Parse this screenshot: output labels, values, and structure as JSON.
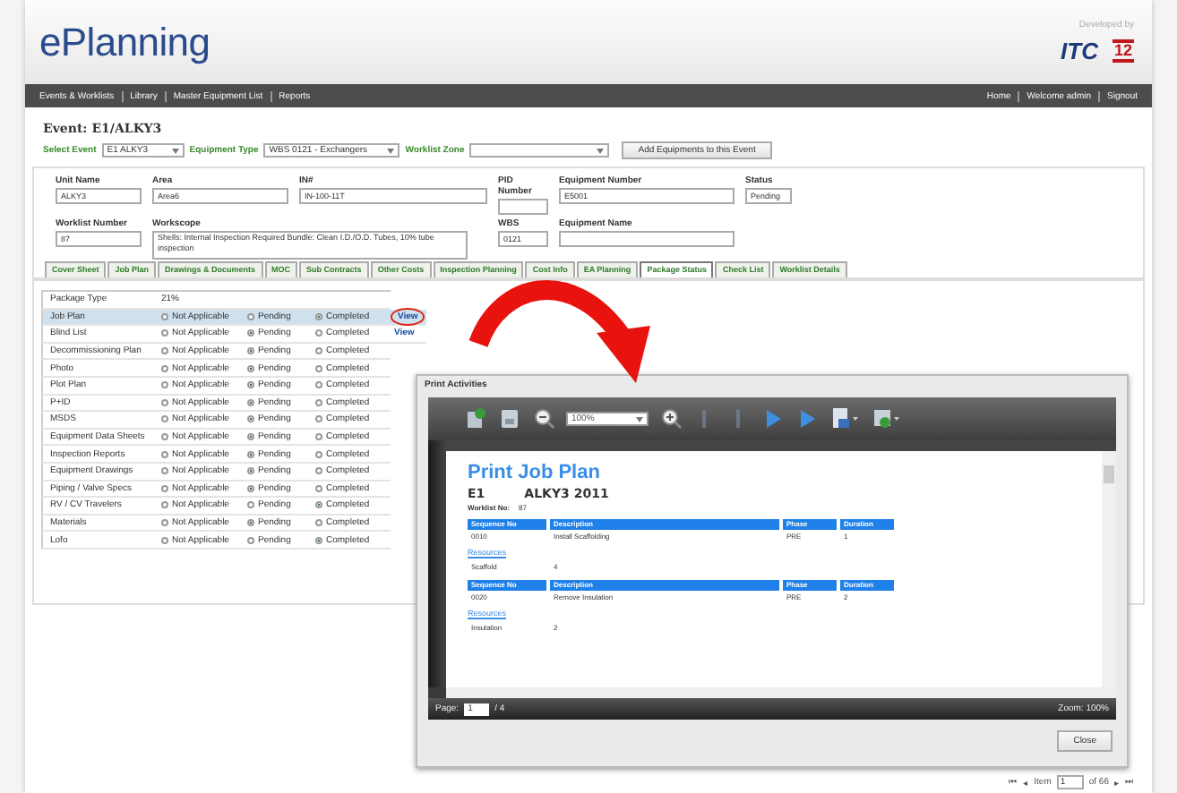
{
  "header": {
    "logo": "ePlanning",
    "developed_by": "Developed by",
    "partner_logo": "ITC",
    "brand_mark": "12"
  },
  "nav": {
    "left": [
      "Events & Worklists",
      "Library",
      "Master Equipment List",
      "Reports"
    ],
    "right": [
      "Home",
      "Welcome admin",
      "Signout"
    ]
  },
  "event_title": "Event: E1/ALKY3",
  "filters": [
    {
      "label": "Select Event",
      "value": "E1 ALKY3"
    },
    {
      "label": "Equipment Type",
      "value": "WBS 0121 - Exchangers"
    },
    {
      "label": "Worklist Zone"
    }
  ],
  "add_button": "Add Equipments to this Event",
  "fields": [
    {
      "kind": "text",
      "label": "Unit Name",
      "value": "ALKY3"
    },
    {
      "kind": "text",
      "label": "Area",
      "value": "Area6"
    },
    {
      "kind": "text",
      "label": "IN#",
      "value": "IN-100-11T"
    },
    {
      "kind": "text",
      "label": "PID Number"
    },
    {
      "kind": "text",
      "label": "Equipment Number",
      "value": "E5001"
    },
    {
      "kind": "text",
      "label": "Status",
      "value": "Pending"
    },
    {
      "kind": "text",
      "label": "Worklist Number",
      "value": "87"
    },
    {
      "kind": "multiline",
      "label": "Workscope",
      "value": "Shells: Internal Inspection Required   Bundle: Clean I.D./O.D. Tubes, 10% tube inspection"
    },
    {
      "kind": "text",
      "label": "WBS",
      "value": "0121"
    },
    {
      "kind": "text",
      "label": "Equipment Name"
    }
  ],
  "tabs": [
    {
      "label": "Cover Sheet",
      "selected": false
    },
    {
      "label": "Job Plan",
      "selected": false
    },
    {
      "label": "Drawings & Documents",
      "selected": false
    },
    {
      "label": "MOC",
      "selected": false
    },
    {
      "label": "Sub Contracts",
      "selected": false
    },
    {
      "label": "Other Costs",
      "selected": false
    },
    {
      "label": "Inspection Planning",
      "selected": false
    },
    {
      "label": "Cost Info",
      "selected": false
    },
    {
      "label": "EA Planning",
      "selected": false
    },
    {
      "label": "Package Status",
      "selected": true
    },
    {
      "label": "Check List",
      "selected": false
    },
    {
      "label": "Worklist Details",
      "selected": false
    }
  ],
  "package_status": {
    "header": {
      "label": "Package Type",
      "value": "21%"
    },
    "rows": [
      {
        "name": "Job Plan",
        "selected": true,
        "view": {
          "label": "View",
          "circled": true
        },
        "options": [
          {
            "label": "Not Applicable",
            "selected": false
          },
          {
            "label": "Pending",
            "selected": false
          },
          {
            "label": "Completed",
            "selected": true
          }
        ]
      },
      {
        "name": "Blind List",
        "selected": false,
        "view": {
          "label": "View",
          "circled": false
        },
        "options": [
          {
            "label": "Not Applicable",
            "selected": false
          },
          {
            "label": "Pending",
            "selected": true
          },
          {
            "label": "Completed",
            "selected": false
          }
        ]
      },
      {
        "name": "Decommissioning Plan",
        "selected": false,
        "options": [
          {
            "label": "Not Applicable",
            "selected": false
          },
          {
            "label": "Pending",
            "selected": true
          },
          {
            "label": "Completed",
            "selected": false
          }
        ]
      },
      {
        "name": "Photo",
        "selected": false,
        "options": [
          {
            "label": "Not Applicable",
            "selected": false
          },
          {
            "label": "Pending",
            "selected": true
          },
          {
            "label": "Completed",
            "selected": false
          }
        ]
      },
      {
        "name": "Plot Plan",
        "selected": false,
        "options": [
          {
            "label": "Not Applicable",
            "selected": false
          },
          {
            "label": "Pending",
            "selected": true
          },
          {
            "label": "Completed",
            "selected": false
          }
        ]
      },
      {
        "name": "P+ID",
        "selected": false,
        "options": [
          {
            "label": "Not Applicable",
            "selected": false
          },
          {
            "label": "Pending",
            "selected": true
          },
          {
            "label": "Completed",
            "selected": false
          }
        ]
      },
      {
        "name": "MSDS",
        "selected": false,
        "options": [
          {
            "label": "Not Applicable",
            "selected": false
          },
          {
            "label": "Pending",
            "selected": true
          },
          {
            "label": "Completed",
            "selected": false
          }
        ]
      },
      {
        "name": "Equipment Data Sheets",
        "selected": false,
        "options": [
          {
            "label": "Not Applicable",
            "selected": false
          },
          {
            "label": "Pending",
            "selected": true
          },
          {
            "label": "Completed",
            "selected": false
          }
        ]
      },
      {
        "name": "Inspection Reports",
        "selected": false,
        "options": [
          {
            "label": "Not Applicable",
            "selected": false
          },
          {
            "label": "Pending",
            "selected": true
          },
          {
            "label": "Completed",
            "selected": false
          }
        ]
      },
      {
        "name": "Equipment Drawings",
        "selected": false,
        "options": [
          {
            "label": "Not Applicable",
            "selected": false
          },
          {
            "label": "Pending",
            "selected": true
          },
          {
            "label": "Completed",
            "selected": false
          }
        ]
      },
      {
        "name": "Piping / Valve Specs",
        "selected": false,
        "options": [
          {
            "label": "Not Applicable",
            "selected": false
          },
          {
            "label": "Pending",
            "selected": true
          },
          {
            "label": "Completed",
            "selected": false
          }
        ]
      },
      {
        "name": "RV / CV Travelers",
        "selected": false,
        "options": [
          {
            "label": "Not Applicable",
            "selected": false
          },
          {
            "label": "Pending",
            "selected": false
          },
          {
            "label": "Completed",
            "selected": true
          }
        ]
      },
      {
        "name": "Materials",
        "selected": false,
        "options": [
          {
            "label": "Not Applicable",
            "selected": false
          },
          {
            "label": "Pending",
            "selected": true
          },
          {
            "label": "Completed",
            "selected": false
          }
        ]
      },
      {
        "name": "Lofo",
        "selected": false,
        "options": [
          {
            "label": "Not Applicable",
            "selected": false
          },
          {
            "label": "Pending",
            "selected": false
          },
          {
            "label": "Completed",
            "selected": true
          }
        ]
      }
    ]
  },
  "dialog": {
    "title": "Print Activities",
    "zoom_value": "100%",
    "document": {
      "title": "Print Job Plan",
      "event": "E1",
      "unit": "ALKY3 2011",
      "worklist_label": "Worklist No:",
      "worklist_value": "87",
      "blocks": [
        {
          "columns": [
            "Sequence No",
            "Description",
            "Phase",
            "Duration"
          ],
          "row": [
            "0010",
            "Install Scaffolding",
            "PRE",
            "1"
          ],
          "resources_link": "Resources",
          "resource": [
            "Scaffold",
            "4"
          ]
        },
        {
          "columns": [
            "Sequence No",
            "Description",
            "Phase",
            "Duration"
          ],
          "row": [
            "0020",
            "Remove Insulation",
            "PRE",
            "2"
          ],
          "resources_link": "Resources",
          "resource": [
            "Insulation",
            "2"
          ]
        }
      ]
    },
    "page_label": "Page:",
    "page_value": "1",
    "page_total": "/ 4",
    "zoom_status": "Zoom: 100%",
    "close_button": "Close"
  },
  "pager": {
    "first": "⏮",
    "prev": "◂",
    "item_label": "Item",
    "item_value": "1",
    "of": "of 66",
    "next": "▸",
    "last": "⏭"
  }
}
